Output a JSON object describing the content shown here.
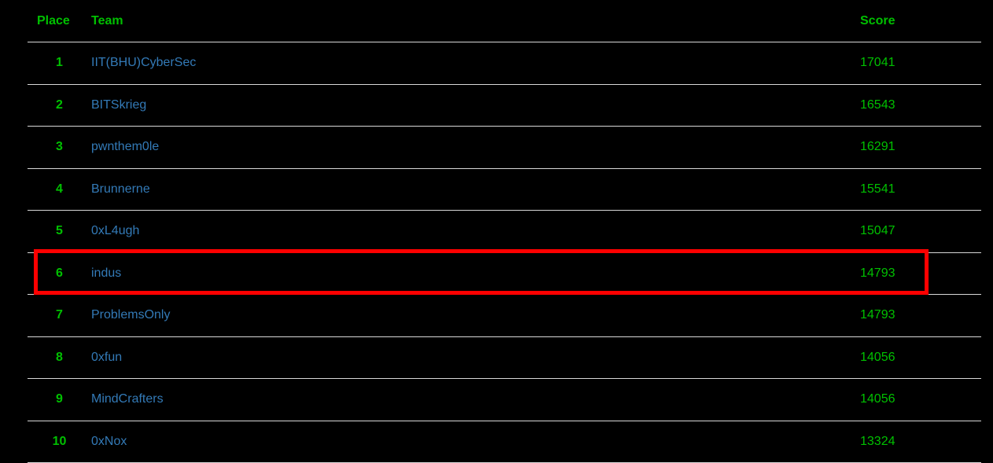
{
  "header": {
    "place_label": "Place",
    "team_label": "Team",
    "score_label": "Score"
  },
  "rows": [
    {
      "place": "1",
      "team": "IIT(BHU)CyberSec",
      "score": "17041"
    },
    {
      "place": "2",
      "team": "BITSkrieg",
      "score": "16543"
    },
    {
      "place": "3",
      "team": "pwnthem0le",
      "score": "16291"
    },
    {
      "place": "4",
      "team": "Brunnerne",
      "score": "15541"
    },
    {
      "place": "5",
      "team": "0xL4ugh",
      "score": "15047"
    },
    {
      "place": "6",
      "team": "indus",
      "score": "14793"
    },
    {
      "place": "7",
      "team": "ProblemsOnly",
      "score": "14793"
    },
    {
      "place": "8",
      "team": "0xfun",
      "score": "14056"
    },
    {
      "place": "9",
      "team": "MindCrafters",
      "score": "14056"
    },
    {
      "place": "10",
      "team": "0xNox",
      "score": "13324"
    }
  ],
  "highlighted_row": "6",
  "colors": {
    "background": "#000000",
    "place_and_score": "#00c000",
    "team_link": "#337ab7",
    "highlight": "#ff0000",
    "row_divider": "#d8d8d8"
  }
}
